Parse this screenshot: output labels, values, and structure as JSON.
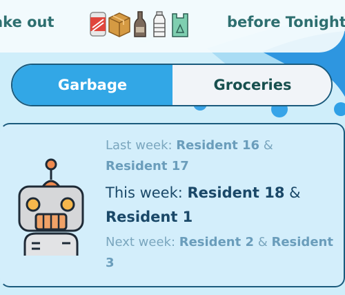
{
  "banner": {
    "left_text": "ake out",
    "right_text": "before Tonight",
    "icons": [
      "soda-can-icon",
      "cardboard-box-icon",
      "glass-bottle-icon",
      "plastic-bottle-icon",
      "recycling-bag-icon"
    ]
  },
  "tabs": [
    {
      "label": "Garbage",
      "selected": true
    },
    {
      "label": "Groceries",
      "selected": false
    }
  ],
  "rotation": {
    "last_week": {
      "prefix": "Last week: ",
      "first": "Resident 16",
      "amp": " & ",
      "second": "Resident 17"
    },
    "this_week": {
      "prefix": "This week: ",
      "first": "Resident 18",
      "amp": " & ",
      "second": "Resident 1"
    },
    "next_week": {
      "prefix": "Next week: ",
      "first": "Resident 2",
      "amp": " & ",
      "second": "Resident 3"
    }
  },
  "colors": {
    "accent": "#32a7e6",
    "dark_teal": "#174f4e",
    "border": "#1a5a7c",
    "muted_text": "#7aa6be"
  }
}
